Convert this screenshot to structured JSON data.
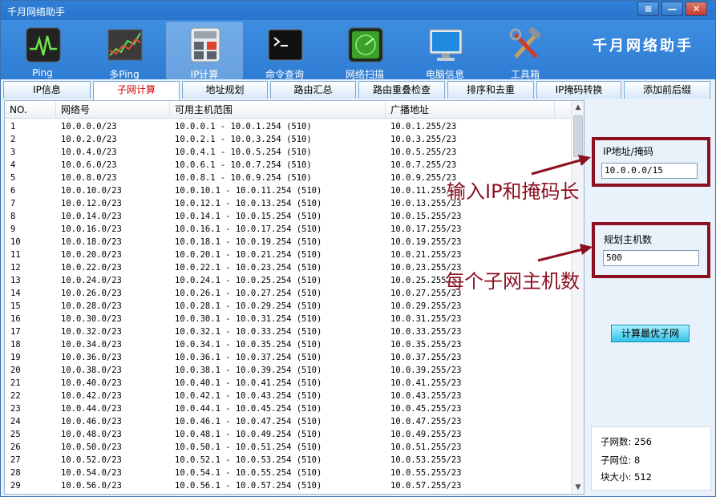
{
  "window": {
    "title": "千月网络助手",
    "controls": [
      "≡",
      "—",
      "✕"
    ]
  },
  "toolbar": {
    "brand": "千月网络助手",
    "tools": [
      {
        "label": "Ping",
        "icon": "ping-monitor-icon"
      },
      {
        "label": "多Ping",
        "icon": "multi-ping-chart-icon"
      },
      {
        "label": "IP计算",
        "icon": "calculator-icon"
      },
      {
        "label": "命令查询",
        "icon": "command-prompt-icon"
      },
      {
        "label": "网络扫描",
        "icon": "radar-scan-icon"
      },
      {
        "label": "电脑信息",
        "icon": "computer-monitor-icon"
      },
      {
        "label": "工具箱",
        "icon": "tools-icon"
      }
    ]
  },
  "tabs": [
    "IP信息",
    "子网计算",
    "地址规划",
    "路由汇总",
    "路由重叠检查",
    "排序和去重",
    "IP掩码转换",
    "添加前后缀"
  ],
  "active_tab": "子网计算",
  "table": {
    "headers": [
      "NO.",
      "网络号",
      "可用主机范围",
      "广播地址"
    ],
    "rows": [
      [
        "1",
        "10.0.0.0/23",
        "10.0.0.1 - 10.0.1.254 (510)",
        "10.0.1.255/23"
      ],
      [
        "2",
        "10.0.2.0/23",
        "10.0.2.1 - 10.0.3.254 (510)",
        "10.0.3.255/23"
      ],
      [
        "3",
        "10.0.4.0/23",
        "10.0.4.1 - 10.0.5.254 (510)",
        "10.0.5.255/23"
      ],
      [
        "4",
        "10.0.6.0/23",
        "10.0.6.1 - 10.0.7.254 (510)",
        "10.0.7.255/23"
      ],
      [
        "5",
        "10.0.8.0/23",
        "10.0.8.1 - 10.0.9.254 (510)",
        "10.0.9.255/23"
      ],
      [
        "6",
        "10.0.10.0/23",
        "10.0.10.1 - 10.0.11.254 (510)",
        "10.0.11.255/23"
      ],
      [
        "7",
        "10.0.12.0/23",
        "10.0.12.1 - 10.0.13.254 (510)",
        "10.0.13.255/23"
      ],
      [
        "8",
        "10.0.14.0/23",
        "10.0.14.1 - 10.0.15.254 (510)",
        "10.0.15.255/23"
      ],
      [
        "9",
        "10.0.16.0/23",
        "10.0.16.1 - 10.0.17.254 (510)",
        "10.0.17.255/23"
      ],
      [
        "10",
        "10.0.18.0/23",
        "10.0.18.1 - 10.0.19.254 (510)",
        "10.0.19.255/23"
      ],
      [
        "11",
        "10.0.20.0/23",
        "10.0.20.1 - 10.0.21.254 (510)",
        "10.0.21.255/23"
      ],
      [
        "12",
        "10.0.22.0/23",
        "10.0.22.1 - 10.0.23.254 (510)",
        "10.0.23.255/23"
      ],
      [
        "13",
        "10.0.24.0/23",
        "10.0.24.1 - 10.0.25.254 (510)",
        "10.0.25.255/23"
      ],
      [
        "14",
        "10.0.26.0/23",
        "10.0.26.1 - 10.0.27.254 (510)",
        "10.0.27.255/23"
      ],
      [
        "15",
        "10.0.28.0/23",
        "10.0.28.1 - 10.0.29.254 (510)",
        "10.0.29.255/23"
      ],
      [
        "16",
        "10.0.30.0/23",
        "10.0.30.1 - 10.0.31.254 (510)",
        "10.0.31.255/23"
      ],
      [
        "17",
        "10.0.32.0/23",
        "10.0.32.1 - 10.0.33.254 (510)",
        "10.0.33.255/23"
      ],
      [
        "18",
        "10.0.34.0/23",
        "10.0.34.1 - 10.0.35.254 (510)",
        "10.0.35.255/23"
      ],
      [
        "19",
        "10.0.36.0/23",
        "10.0.36.1 - 10.0.37.254 (510)",
        "10.0.37.255/23"
      ],
      [
        "20",
        "10.0.38.0/23",
        "10.0.38.1 - 10.0.39.254 (510)",
        "10.0.39.255/23"
      ],
      [
        "21",
        "10.0.40.0/23",
        "10.0.40.1 - 10.0.41.254 (510)",
        "10.0.41.255/23"
      ],
      [
        "22",
        "10.0.42.0/23",
        "10.0.42.1 - 10.0.43.254 (510)",
        "10.0.43.255/23"
      ],
      [
        "23",
        "10.0.44.0/23",
        "10.0.44.1 - 10.0.45.254 (510)",
        "10.0.45.255/23"
      ],
      [
        "24",
        "10.0.46.0/23",
        "10.0.46.1 - 10.0.47.254 (510)",
        "10.0.47.255/23"
      ],
      [
        "25",
        "10.0.48.0/23",
        "10.0.48.1 - 10.0.49.254 (510)",
        "10.0.49.255/23"
      ],
      [
        "26",
        "10.0.50.0/23",
        "10.0.50.1 - 10.0.51.254 (510)",
        "10.0.51.255/23"
      ],
      [
        "27",
        "10.0.52.0/23",
        "10.0.52.1 - 10.0.53.254 (510)",
        "10.0.53.255/23"
      ],
      [
        "28",
        "10.0.54.0/23",
        "10.0.54.1 - 10.0.55.254 (510)",
        "10.0.55.255/23"
      ],
      [
        "29",
        "10.0.56.0/23",
        "10.0.56.1 - 10.0.57.254 (510)",
        "10.0.57.255/23"
      ]
    ]
  },
  "form": {
    "ip_label": "IP地址/掩码",
    "ip_value": "10.0.0.0/15",
    "hosts_label": "规划主机数",
    "hosts_value": "500",
    "calc_button": "计算最优子网"
  },
  "annotations": {
    "ip_note": "输入IP和掩码长",
    "hosts_note": "每个子网主机数"
  },
  "stats": {
    "subnet_count": "子网数: 256",
    "subnet_bits": "子网位: 8",
    "block_size": "块大小: 512"
  },
  "colors": {
    "titlebar": "#2f7fd6",
    "toolbar": "#3d8de0",
    "annotation_red": "#8c1020",
    "active_tab_text": "#d00000",
    "button_cyan": "#33c2e8"
  }
}
